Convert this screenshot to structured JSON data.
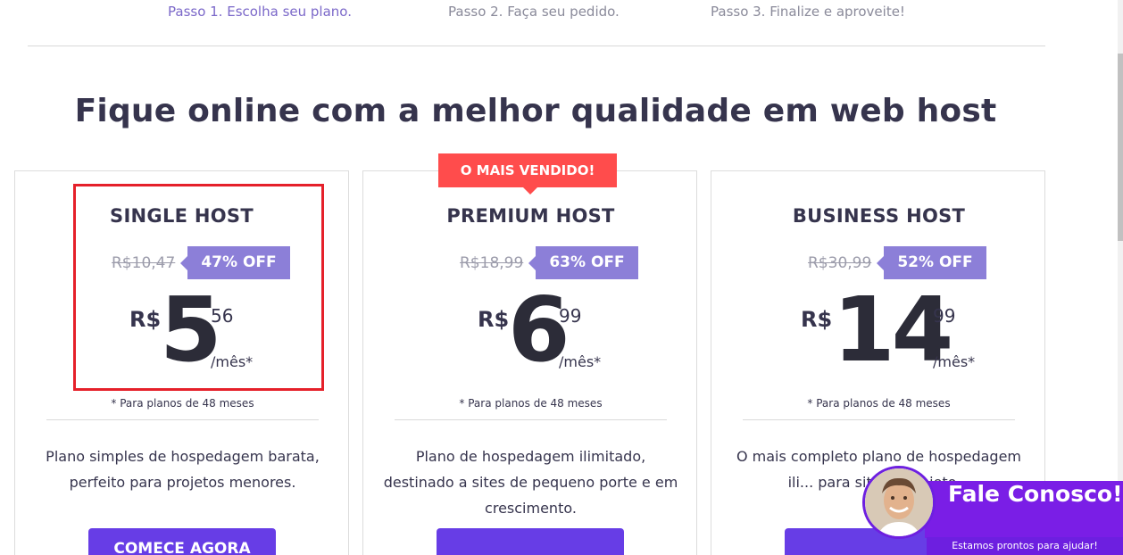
{
  "steps": [
    {
      "label": "Passo 1.  Escolha seu plano."
    },
    {
      "label": "Passo 2.  Faça seu pedido."
    },
    {
      "label": "Passo 3.  Finalize e aproveite!"
    }
  ],
  "headline": {
    "before": "Fique online com a ",
    "bold": "melhor qualidade",
    "after": " em web host"
  },
  "best_seller_badge": "O MAIS VENDIDO!",
  "plans": [
    {
      "name": "SINGLE HOST",
      "old_price": "R$10,47",
      "discount": "47% OFF",
      "currency": "R$",
      "price_int": "5",
      "price_cents": "56",
      "period": "/mês*",
      "fine_print": "* Para planos de 48 meses",
      "desc": "Plano simples de hospedagem barata, perfeito para projetos menores.",
      "cta": "COMECE AGORA"
    },
    {
      "name": "PREMIUM HOST",
      "old_price": "R$18,99",
      "discount": "63% OFF",
      "currency": "R$",
      "price_int": "6",
      "price_cents": "99",
      "period": "/mês*",
      "fine_print": "* Para planos de 48 meses",
      "desc": "Plano de hospedagem ilimitado, destinado a sites de pequeno porte e em crescimento.",
      "cta": ""
    },
    {
      "name": "BUSINESS HOST",
      "old_price": "R$30,99",
      "discount": "52% OFF",
      "currency": "R$",
      "price_int": "14",
      "price_cents": "99",
      "period": "/mês*",
      "fine_print": "* Para planos de 48 meses",
      "desc": "O mais completo plano de hospedagem ili... para sites e projeto...",
      "cta": ""
    }
  ],
  "chat": {
    "title": "Fale Conosco!",
    "subtitle": "Estamos prontos para ajudar!"
  },
  "colors": {
    "accent": "#673de6",
    "discount": "#8c7fd8",
    "badge": "#ff4c4c",
    "highlight": "#e5202a"
  }
}
